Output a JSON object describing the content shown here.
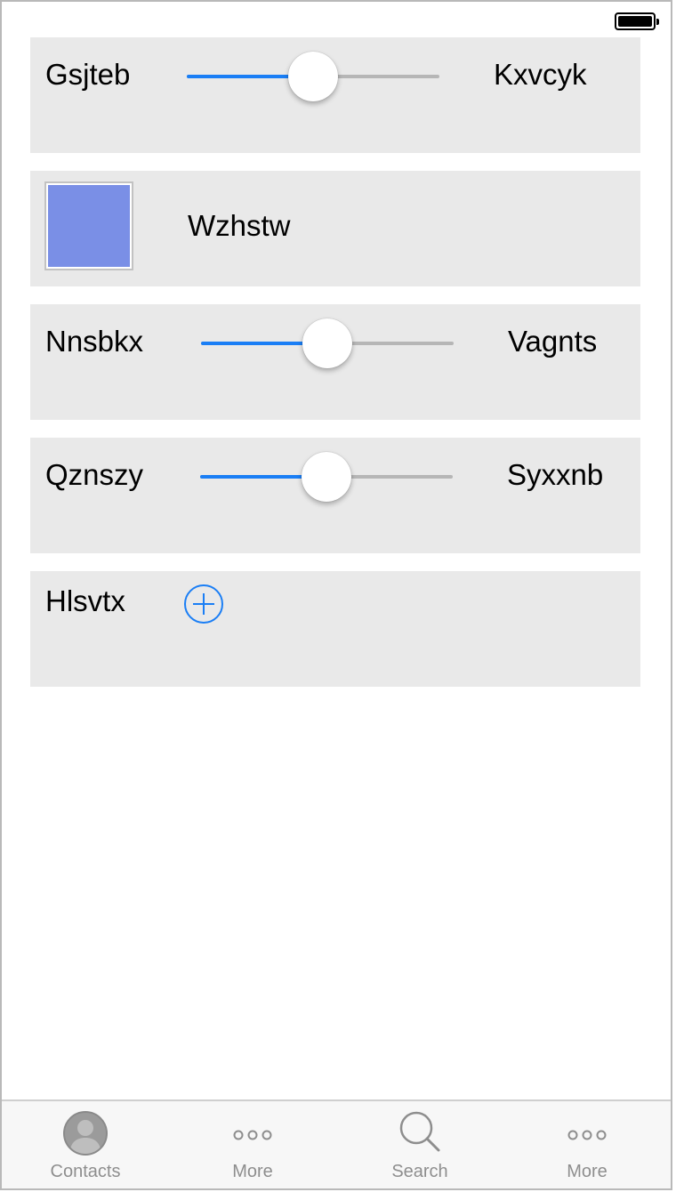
{
  "status_bar": {
    "battery": "full"
  },
  "rows": [
    {
      "type": "slider",
      "left_label": "Gsjteb",
      "right_label": "Kxvcyk",
      "value": 0.5
    },
    {
      "type": "color",
      "label": "Wzhstw",
      "color": "#7a8fe6"
    },
    {
      "type": "slider",
      "left_label": "Nnsbkx",
      "right_label": "Vagnts",
      "value": 0.5
    },
    {
      "type": "slider",
      "left_label": "Qznszy",
      "right_label": "Syxxnb",
      "value": 0.5
    },
    {
      "type": "add",
      "label": "Hlsvtx",
      "icon": "plus-circle-icon"
    }
  ],
  "tab_bar": {
    "tabs": [
      {
        "label": "Contacts",
        "icon": "contacts-icon"
      },
      {
        "label": "More",
        "icon": "more-icon"
      },
      {
        "label": "Search",
        "icon": "search-icon"
      },
      {
        "label": "More",
        "icon": "more-icon"
      }
    ]
  },
  "colors": {
    "accent": "#1a7ef5",
    "cell_background": "#e9e9e9",
    "track": "#b6b6b6",
    "tab_inactive": "#8e8e8e"
  }
}
